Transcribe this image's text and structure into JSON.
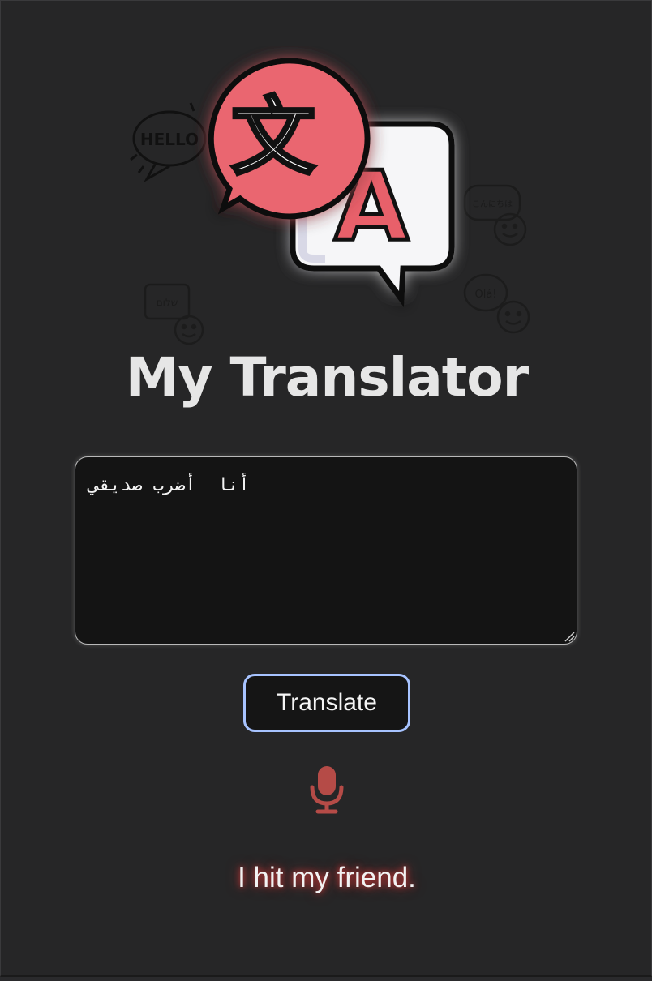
{
  "app": {
    "title": "My Translator"
  },
  "logo": {
    "bubble_glyphs": {
      "kanji": "文",
      "latin": "A"
    },
    "greetings": [
      "HELLO",
      "こんにちは",
      "Olá!",
      "שלום"
    ]
  },
  "input": {
    "value": "أنا  أضرب صديقي",
    "placeholder": ""
  },
  "actions": {
    "translate_label": "Translate"
  },
  "icons": {
    "mic": "microphone-icon"
  },
  "output": {
    "translation": "I hit my friend."
  },
  "colors": {
    "background": "#262627",
    "accent_red": "#e8606a",
    "button_border": "#a7c3ff",
    "mic": "#b54b47"
  }
}
